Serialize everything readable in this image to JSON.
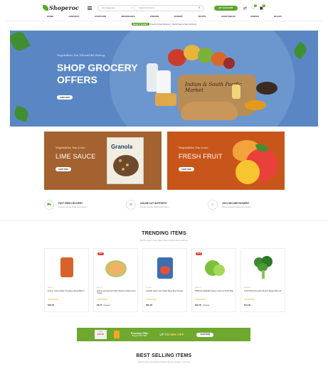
{
  "header": {
    "logo_text": "Shoperoc",
    "search_category": "All Categories",
    "search_placeholder": "Search Products",
    "account_label": "MY ACCOUNT",
    "wishlist_count": "0",
    "cart_count": "0"
  },
  "nav": [
    "HOME",
    "GROCERY",
    "FASTFOOD",
    "BEVERAGES",
    "FROZEN",
    "BAKERY",
    "FRUITS",
    "VEGETABLES",
    "DRINKS",
    "BLOGS"
  ],
  "promo": {
    "tag": "Need It Today?",
    "text": "Fresh & Fast Delivery",
    "text2": "$0.00 Same Day Delivery"
  },
  "hero": {
    "kicker": "Vegetables You Should Be Eating",
    "title": "SHOP GROCERY OFFERS",
    "button": "SHOP NOW",
    "basket_label": "Indian & South Pacific Market"
  },
  "banners": [
    {
      "kicker": "Vegetables You Love",
      "title": "LIME SAUCE",
      "button": "SHOP NOW",
      "product_name": "Granola"
    },
    {
      "kicker": "Vegetables You Love",
      "title": "FRESH FRUIT",
      "button": "SHOP NOW"
    }
  ],
  "features": [
    {
      "icon": "truck-icon",
      "title": "FAST FREE DELIVERY",
      "sub": "Donkey popular belief ipsum ipsum"
    },
    {
      "icon": "chat-icon",
      "title": "ONLINE 24/7 SUPPORTS",
      "sub": "Donkey popular belief ipsum ipsum"
    },
    {
      "icon": "card-icon",
      "title": "100% SECURE PAYMENT",
      "sub": "Donkey popular belief ipsum ipsum"
    }
  ],
  "trending": {
    "title": "TRENDING ITEMS",
    "subtitle": "Electric easy to stand Take a look at these trendy products",
    "products": [
      {
        "sale": "",
        "category": "BULK-Y",
        "name": "Frozen Sylvie Whole Tomatoes Mixed Bacon",
        "stars": "★★★★★",
        "rating": "(1)",
        "price": "$28.00",
        "old_price": ""
      },
      {
        "sale": "SALE",
        "category": "BULK-Y",
        "name": "Marine Homegrown Melon Mature Hollow Food Cubed",
        "stars": "★★★★★",
        "rating": "(1)",
        "price": "$8.25",
        "old_price": "$12.00"
      },
      {
        "sale": "",
        "category": "FOODS",
        "name": "Gorbilla Japan Vine Italian Bean Plus Cheese",
        "stars": "★★★★★",
        "rating": "(1)",
        "price": "$60.00",
        "old_price": ""
      },
      {
        "sale": "SALE",
        "category": "FRUITS",
        "name": "PRINCE CHEESE Organic raw lime Fresh Bag",
        "stars": "★★★★★",
        "rating": "(1)",
        "price": "$20.00",
        "old_price": "$24.00"
      },
      {
        "sale": "",
        "category": "BUNDLE",
        "name": "Fresh Broccoli Garden Bunch Ready Broccoli",
        "stars": "★★★★★",
        "rating": "(1)",
        "price": "$10.00",
        "old_price": ""
      }
    ]
  },
  "offer": {
    "tag_top": "Only",
    "tag_price": "$20.00",
    "title": "Premium Offer",
    "subtitle": "Biggest Offer Sale",
    "percent_prefix": "UP TO",
    "percent": "50% OFF",
    "button": "SHOP NOW"
  },
  "best_selling": {
    "title": "BEST SELLING ITEMS",
    "subtitle": "Explore these best selling products that are popular in our shop"
  },
  "colors": {
    "brand_green": "#5aa62b",
    "hero_blue": "#5a87c4",
    "banner_brown": "#a3622f",
    "banner_orange": "#c8561a",
    "sale_red": "#e53935"
  }
}
